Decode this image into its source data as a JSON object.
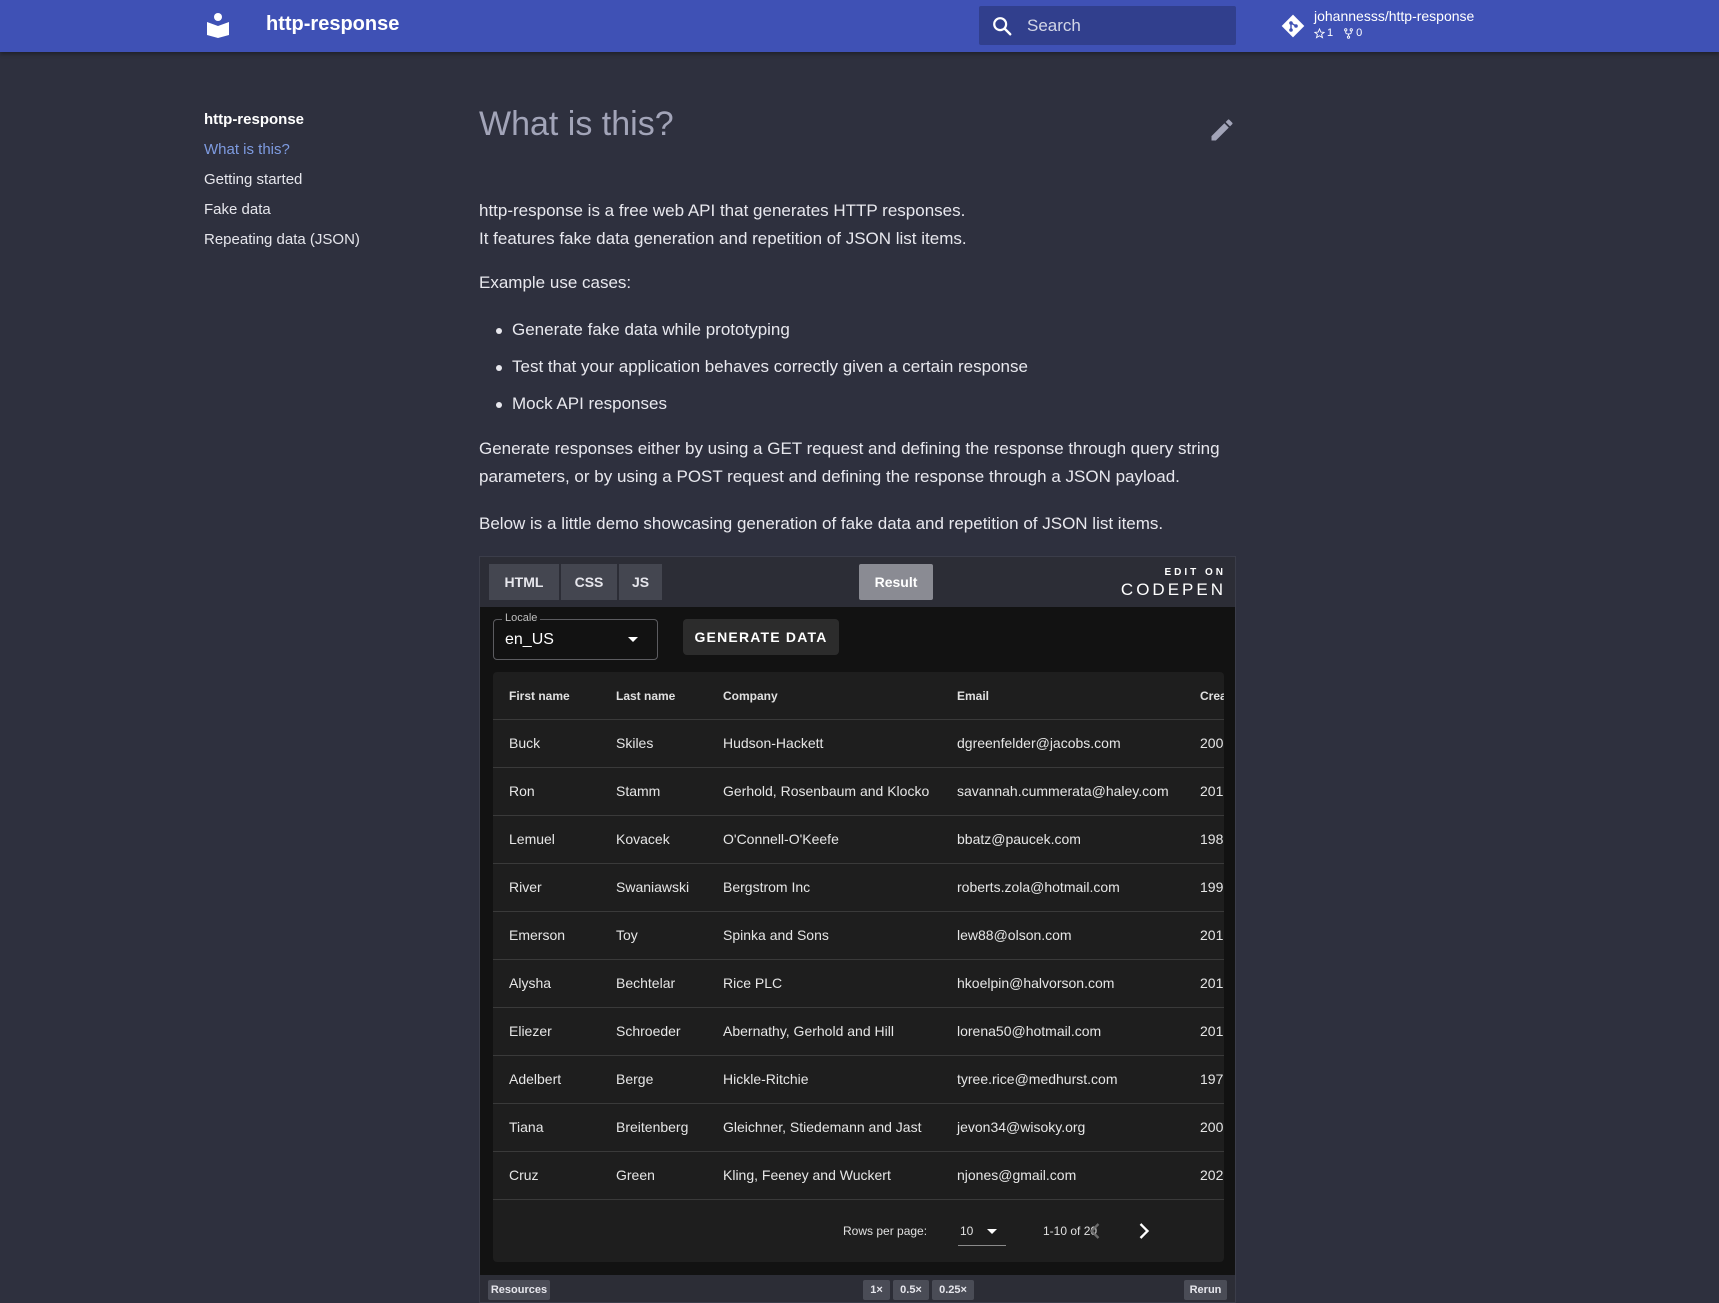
{
  "header": {
    "site_title": "http-response",
    "search_placeholder": "Search",
    "repo_name": "johannesss/http-response",
    "stars": "1",
    "forks": "0"
  },
  "sidebar": {
    "title": "http-response",
    "items": [
      {
        "label": "What is this?",
        "active": true
      },
      {
        "label": "Getting started"
      },
      {
        "label": "Fake data"
      },
      {
        "label": "Repeating data (JSON)"
      }
    ]
  },
  "main": {
    "title": "What is this?",
    "intro_line1": "http-response is a free web API that generates HTTP responses.",
    "intro_line2": "It features fake data generation and repetition of JSON list items.",
    "use_cases_heading": "Example use cases:",
    "use_cases": [
      "Generate fake data while prototyping",
      "Test that your application behaves correctly given a certain response",
      "Mock API responses"
    ],
    "generate_paragraph": "Generate responses either by using a GET request and defining the response through query string parameters, or by using a POST request and defining the response through a JSON payload.",
    "demo_paragraph": "Below is a little demo showcasing generation of fake data and repetition of JSON list items."
  },
  "codepen": {
    "tabs": [
      "HTML",
      "CSS",
      "JS"
    ],
    "result_label": "Result",
    "edit_on": "EDIT ON",
    "brand": "CODEPEN",
    "locale_label": "Locale",
    "locale_value": "en_US",
    "generate_button": "GENERATE DATA",
    "columns": [
      "First name",
      "Last name",
      "Company",
      "Email",
      "Crea"
    ],
    "rows": [
      [
        "Buck",
        "Skiles",
        "Hudson-Hackett",
        "dgreenfelder@jacobs.com",
        "200"
      ],
      [
        "Ron",
        "Stamm",
        "Gerhold, Rosenbaum and Klocko",
        "savannah.cummerata@haley.com",
        "201"
      ],
      [
        "Lemuel",
        "Kovacek",
        "O'Connell-O'Keefe",
        "bbatz@paucek.com",
        "198"
      ],
      [
        "River",
        "Swaniawski",
        "Bergstrom Inc",
        "roberts.zola@hotmail.com",
        "199"
      ],
      [
        "Emerson",
        "Toy",
        "Spinka and Sons",
        "lew88@olson.com",
        "201"
      ],
      [
        "Alysha",
        "Bechtelar",
        "Rice PLC",
        "hkoelpin@halvorson.com",
        "201"
      ],
      [
        "Eliezer",
        "Schroeder",
        "Abernathy, Gerhold and Hill",
        "lorena50@hotmail.com",
        "201"
      ],
      [
        "Adelbert",
        "Berge",
        "Hickle-Ritchie",
        "tyree.rice@medhurst.com",
        "197"
      ],
      [
        "Tiana",
        "Breitenberg",
        "Gleichner, Stiedemann and Jast",
        "jevon34@wisoky.org",
        "200"
      ],
      [
        "Cruz",
        "Green",
        "Kling, Feeney and Wuckert",
        "njones@gmail.com",
        "202"
      ]
    ],
    "rows_per_page_label": "Rows per page:",
    "rows_per_page": "10",
    "page_range": "1-10 of 20",
    "footer": {
      "resources": "Resources",
      "zoom_options": [
        "1×",
        "0.5×",
        "0.25×"
      ],
      "rerun": "Rerun"
    }
  },
  "colors": {
    "header": "#3f51b5",
    "page_bg": "#2e303e",
    "active_link": "#7e9be0"
  }
}
